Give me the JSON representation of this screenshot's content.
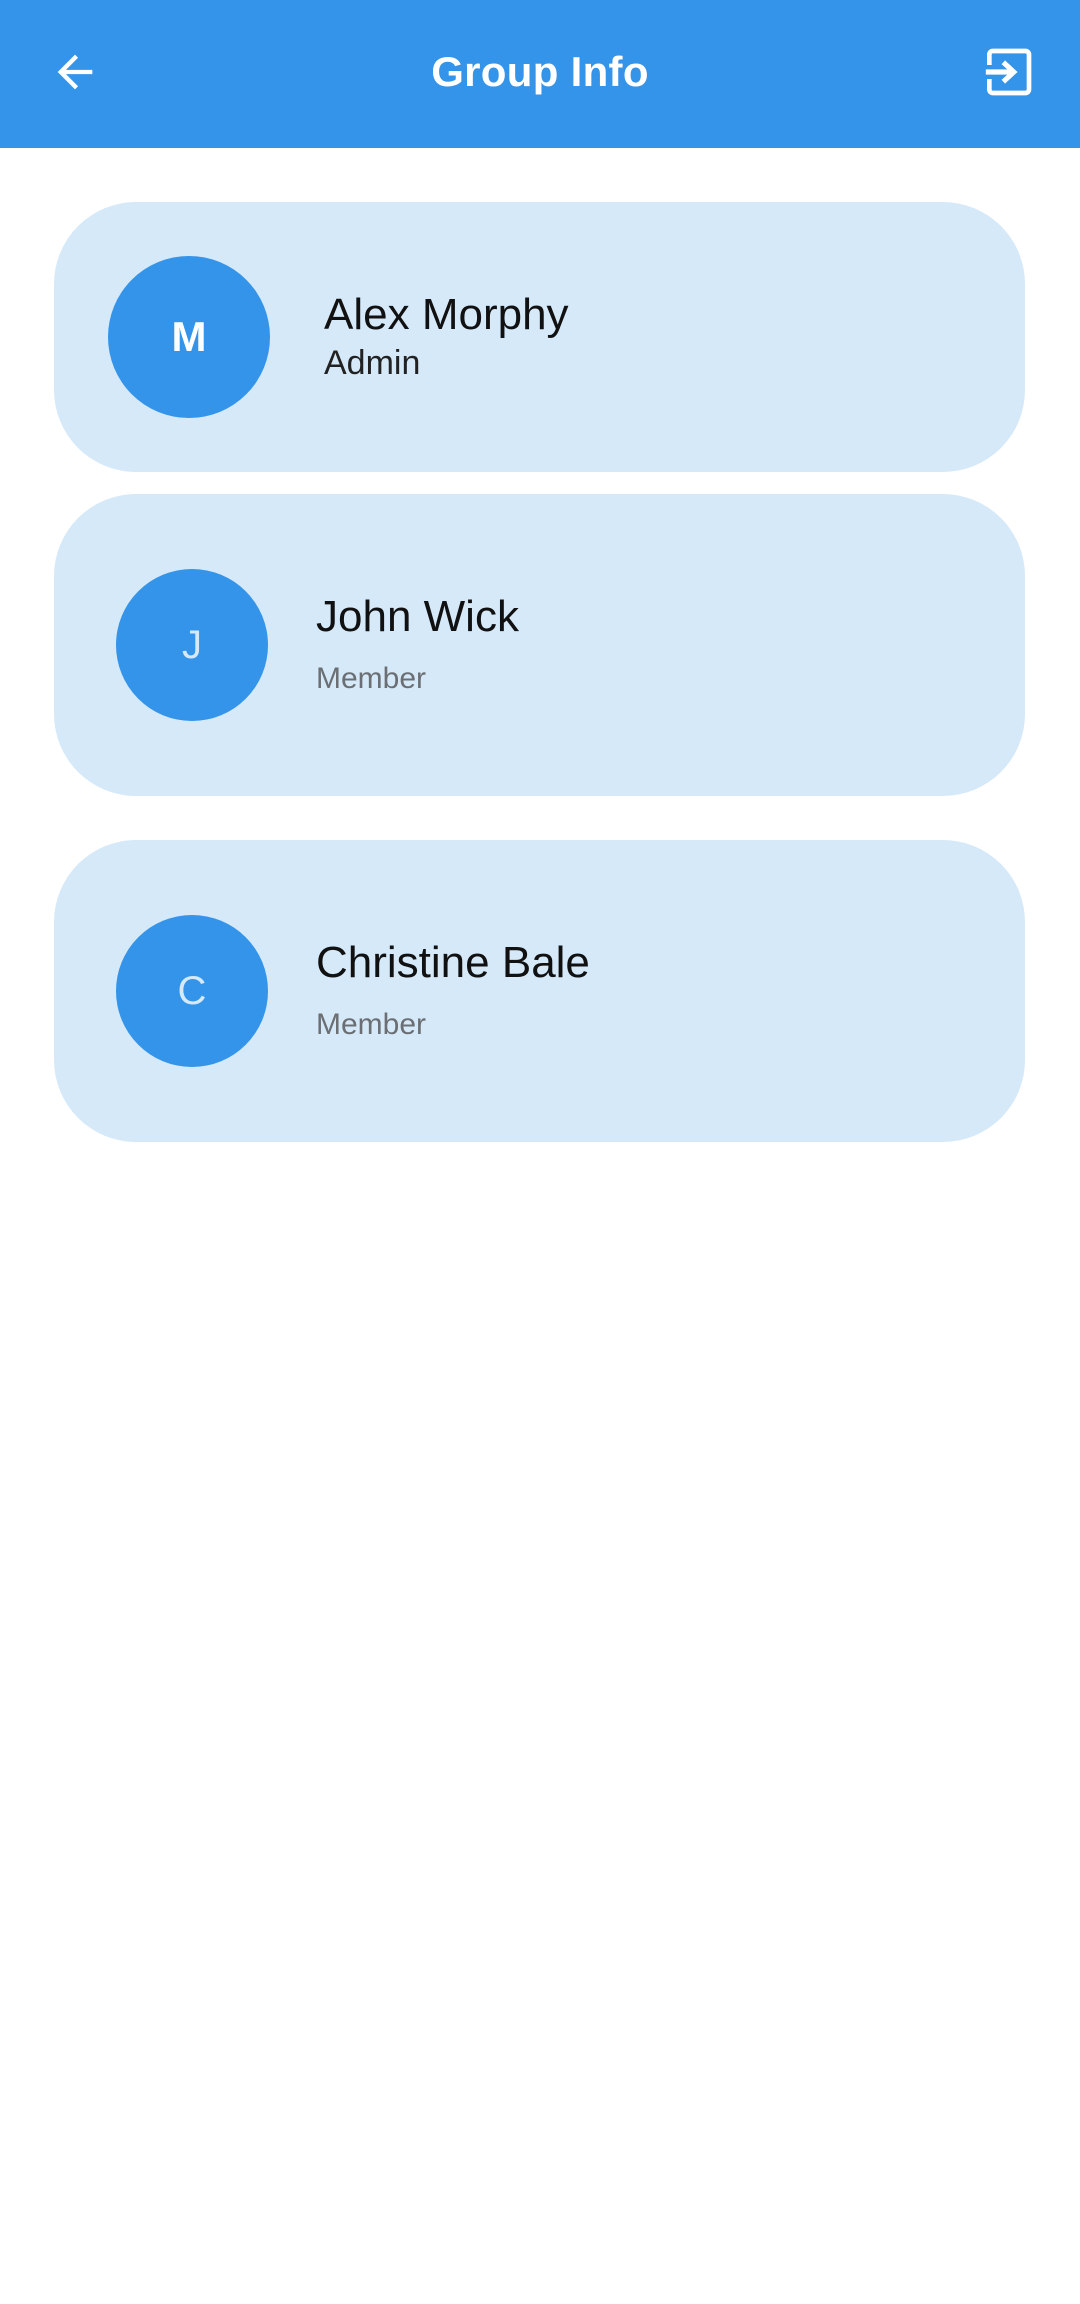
{
  "appbar": {
    "title": "Group Info",
    "back_icon": "arrow-left-icon",
    "exit_icon": "exit-to-app-icon"
  },
  "colors": {
    "primary": "#3394EA",
    "card_background": "#D5E9F9",
    "background": "#FFFFFF"
  },
  "members": [
    {
      "initial": "M",
      "name": "Alex Morphy",
      "role": "Admin"
    },
    {
      "initial": "J",
      "name": "John Wick",
      "role": "Member"
    },
    {
      "initial": "C",
      "name": "Christine Bale",
      "role": "Member"
    }
  ]
}
